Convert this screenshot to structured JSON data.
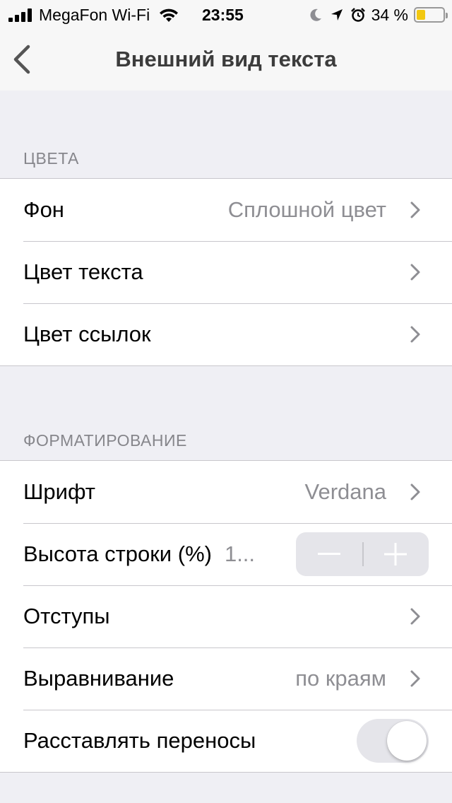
{
  "status_bar": {
    "carrier": "MegaFon Wi-Fi",
    "time": "23:55",
    "battery_percent": "34 %",
    "battery_level": 0.34,
    "icons": [
      "signal-icon",
      "wifi-icon",
      "moon-icon",
      "location-icon",
      "alarm-icon",
      "battery-icon"
    ]
  },
  "nav": {
    "title": "Внешний вид текста",
    "back_icon": "chevron-left-icon"
  },
  "colors_section": {
    "header": "ЦВЕТА",
    "rows": [
      {
        "label": "Фон",
        "value": "Сплошной цвет"
      },
      {
        "label": "Цвет текста",
        "value": ""
      },
      {
        "label": "Цвет ссылок",
        "value": ""
      }
    ]
  },
  "formatting_section": {
    "header": "ФОРМАТИРОВАНИЕ",
    "font": {
      "label": "Шрифт",
      "value": "Verdana"
    },
    "line_height": {
      "label": "Высота строки (%)",
      "value": "1...",
      "minus": "−",
      "plus": "+"
    },
    "margins": {
      "label": "Отступы"
    },
    "alignment": {
      "label": "Выравнивание",
      "value": "по краям"
    },
    "hyphenation": {
      "label": "Расставлять переносы",
      "enabled": false
    }
  },
  "colors": {
    "accent": "#007aff",
    "background": "#efeff4",
    "secondary_text": "#8e8e93",
    "battery": "#f2c811"
  }
}
